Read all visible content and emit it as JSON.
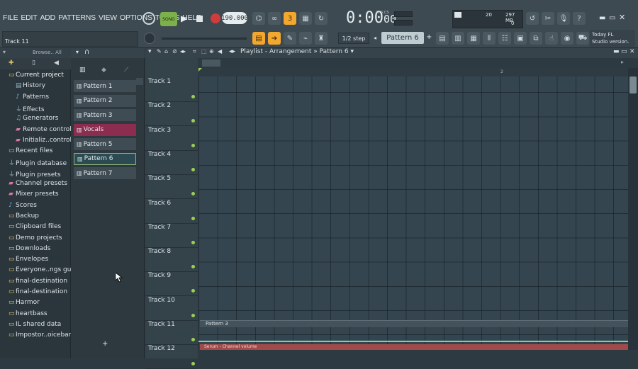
{
  "menu": [
    "FILE",
    "EDIT",
    "ADD",
    "PATTERNS",
    "VIEW",
    "OPTIONS",
    "TOOLS",
    "HELP"
  ],
  "transport": {
    "song_label": "SONG",
    "bpm": "190.000",
    "time": "0:00",
    "time_frac": "00",
    "time_unit": "M:S:CS"
  },
  "hint": {
    "text": "Track 11"
  },
  "toolbar": {
    "step": "1/2 step",
    "pattern": "Pattern 6"
  },
  "cpu": {
    "value_a": "20",
    "memory": "297 MB",
    "value_b": "0"
  },
  "news": {
    "line1": "Today  FL",
    "line2": "Studio version."
  },
  "browser": {
    "header": "Browse.. All",
    "items": [
      {
        "label": "Current project",
        "icon": "folder-icon",
        "level": 0
      },
      {
        "label": "History",
        "icon": "history-icon",
        "level": 1
      },
      {
        "label": "Patterns",
        "icon": "note-icon",
        "level": 1
      },
      {
        "label": "Effects",
        "icon": "plug-icon",
        "level": 1
      },
      {
        "label": "Generators",
        "icon": "generator-icon",
        "level": 1
      },
      {
        "label": "Remote control",
        "icon": "remote-icon",
        "level": 1
      },
      {
        "label": "Initializ..controls",
        "icon": "init-icon",
        "level": 1
      },
      {
        "label": "Recent files",
        "icon": "folder-icon",
        "level": 0
      },
      {
        "label": "Plugin database",
        "icon": "plug-icon",
        "level": 0
      },
      {
        "label": "Plugin presets",
        "icon": "plug-icon",
        "level": 0
      },
      {
        "label": "Channel presets",
        "icon": "channel-icon",
        "level": 0
      },
      {
        "label": "Mixer presets",
        "icon": "mixer-icon",
        "level": 0
      },
      {
        "label": "Scores",
        "icon": "note-icon",
        "level": 0
      },
      {
        "label": "Backup",
        "icon": "folder-icon",
        "level": 0
      },
      {
        "label": "Clipboard files",
        "icon": "folder-icon",
        "level": 0
      },
      {
        "label": "Demo projects",
        "icon": "folder-icon",
        "level": 0
      },
      {
        "label": "Downloads",
        "icon": "folder-icon",
        "level": 0
      },
      {
        "label": "Envelopes",
        "icon": "folder-icon",
        "level": 0
      },
      {
        "label": "Everyone..ngs guns",
        "icon": "folder-icon",
        "level": 0
      },
      {
        "label": "final-destination",
        "icon": "folder-icon",
        "level": 0
      },
      {
        "label": "final-destination",
        "icon": "folder-icon",
        "level": 0
      },
      {
        "label": "Harmor",
        "icon": "folder-icon",
        "level": 0
      },
      {
        "label": "heartbass",
        "icon": "folder-icon",
        "level": 0
      },
      {
        "label": "IL shared data",
        "icon": "folder-icon",
        "level": 0
      },
      {
        "label": "Impostor..oicebank",
        "icon": "folder-icon",
        "level": 0
      }
    ]
  },
  "rack": {
    "patterns": [
      "Pattern 1",
      "Pattern 2",
      "Pattern 3",
      "Vocals",
      "Pattern 5",
      "Pattern 6",
      "Pattern 7"
    ],
    "add": "+"
  },
  "playlist": {
    "title": "Playlist - Arrangement",
    "pattern": "Pattern 6",
    "ruler_mark": "2",
    "tracks": [
      "Track 1",
      "Track 2",
      "Track 3",
      "Track 4",
      "Track 5",
      "Track 6",
      "Track 7",
      "Track 8",
      "Track 9",
      "Track 10",
      "Track 11",
      "Track 12"
    ],
    "clip_track11": "Pattern 3",
    "clip_track12": "Serum - Channel volume"
  }
}
